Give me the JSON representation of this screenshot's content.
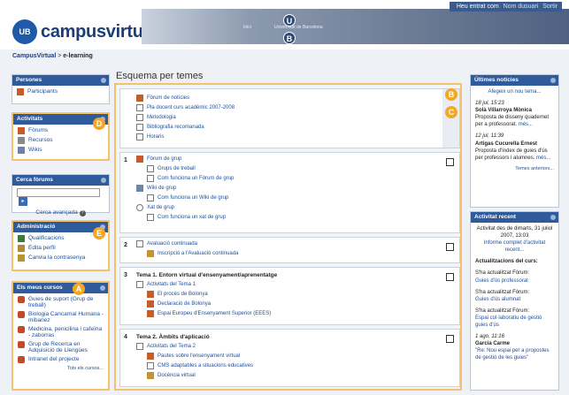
{
  "header": {
    "logo_badge": "UB",
    "logo_text": "campusvirtual",
    "banner_links": [
      "Inici",
      "Universitat de Barcelona"
    ],
    "user_bar": {
      "text": "Heu entrat com",
      "name": "Nom dusuari",
      "logout": "Sortir"
    }
  },
  "markers": {
    "U": "U",
    "B": "B",
    "A": "A",
    "C": "C",
    "D": "D",
    "E": "E"
  },
  "breadcrumb": {
    "root": "CampusVirtual",
    "sep": ">",
    "current": "e-learning"
  },
  "left": {
    "persones": {
      "title": "Persones",
      "items": [
        "Participants"
      ]
    },
    "activitats": {
      "title": "Activitats",
      "items": [
        "Fòrums",
        "Recursos",
        "Wikis"
      ]
    },
    "cerca": {
      "title": "Cerca fòrums",
      "go": "▸",
      "advanced": "Cerca avançada",
      "help": "?"
    },
    "admin": {
      "title": "Administració",
      "items": [
        "Qualificacions",
        "Edita perfil",
        "Canvia la contrasenya"
      ]
    },
    "cursos": {
      "title": "Els meus cursos",
      "items": [
        "Guies de suport (Grup de treball)",
        "Biologia Cancarnal Humana - mibanez",
        "Medicina, penicilina i cafeïna - zaborras",
        "Grup de Recerca en Adquisició de Llengües",
        "Intranet del projecte"
      ],
      "all": "Tots els cursos..."
    }
  },
  "main": {
    "title": "Esquema per temes",
    "section0": [
      "Fòrum de notícies",
      "Pla docent curs acadèmic 2007-2008",
      "Metodologia",
      "Bibliografia recomanada",
      "Horaris"
    ],
    "section1": {
      "num": "1",
      "items": [
        "Fòrum de grup",
        "Grups de treball",
        "Com funciona un Fòrum de grup",
        "Wiki de grup",
        "Com funciona un Wiki de grup",
        "Xat de grup",
        "Com funciona un xat de grup"
      ]
    },
    "section2": {
      "num": "2",
      "items": [
        "Avaluació continuada",
        "Inscripció a l'Avaluació continuada"
      ]
    },
    "section3": {
      "num": "3",
      "title": "Tema 1. Entorn virtual d'ensenyament/aprenentatge",
      "items": [
        "Activitats del Tema 1",
        "El procés de Bolonya",
        "Declaració de Bolonya",
        "Espai Europeu d'Ensenyament Superior (EEES)"
      ]
    },
    "section4": {
      "num": "4",
      "title": "Tema 2. Àmbits d'aplicació",
      "items": [
        "Activitats del Tema 2",
        "Pautes sobre l'ensenyament virtual",
        "CMS adaptables a situacions educatives",
        "Docència virtual"
      ]
    }
  },
  "right": {
    "news": {
      "title": "Últimes notícies",
      "add": "Afegeix un nou tema...",
      "entries": [
        {
          "date": "18 jul, 15:23",
          "author": "Solà Villarroya Mònica",
          "text": "Proposta de disseny quadernet per a professorat.",
          "more": "més..."
        },
        {
          "date": "12 jul, 11:39",
          "author": "Artigas Cucurella Ernest",
          "text": "Proposta d'índex de guies d'ús per professors i alumnes.",
          "more": "més..."
        }
      ],
      "older": "Temes anteriors..."
    },
    "recent": {
      "title": "Activitat recent",
      "since": "Activitat des de dimarts, 31 juliol 2007, 13:03",
      "full_report": "Informe complet d'activitat recent...",
      "updates_title": "Actualitzacions del curs:",
      "updates": [
        {
          "label": "S'ha actualitzat Fòrum:",
          "link": "Guies d'ús professorat"
        },
        {
          "label": "S'ha actualitzat Fòrum:",
          "link": "Guies d'ús alumnat"
        },
        {
          "label": "S'ha actualitzat Fòrum:",
          "link": "Espai col·laboratiu de gestió guies d'ús"
        }
      ],
      "last": {
        "date": "1 ago, 11:16",
        "author": "Garcia Carme",
        "text": "\"Re: Nou espai per a propostes de gestió de les guies\""
      }
    }
  }
}
